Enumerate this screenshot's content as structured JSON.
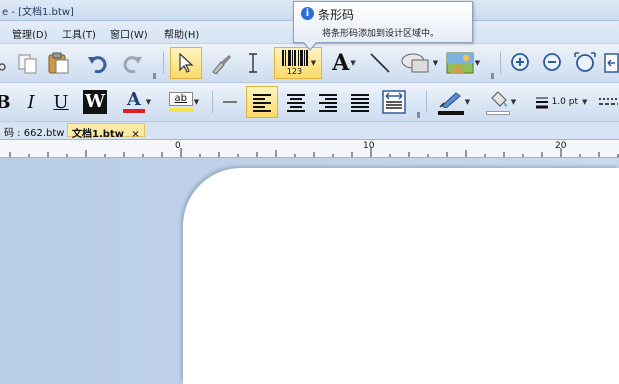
{
  "window": {
    "title": "e - [文档1.btw]"
  },
  "menu": {
    "items": [
      "管理(D)",
      "工具(T)",
      "窗口(W)",
      "帮助(H)"
    ]
  },
  "tooltip": {
    "title": "条形码",
    "description": "将条形码添加到设计区域中。"
  },
  "toolbar": {
    "barcode_caption": "123",
    "font_glyph": "A",
    "italic": "I",
    "underline": "U",
    "wordart": "W",
    "font_color_glyph": "A",
    "highlight_text": "ab",
    "line_width": "1.0 pt"
  },
  "doc_tabs": [
    {
      "label": "码 : 662.btw",
      "active": false
    },
    {
      "label": "文档1.btw",
      "active": true,
      "close": "×"
    }
  ],
  "ruler": {
    "labels": [
      "0",
      "10",
      "20"
    ]
  },
  "colors": {
    "workspace": "#c3d4e8",
    "toolbar_hover": "#fbd96a",
    "font_color_underline": "#e02020",
    "info_blue": "#2a6fd6"
  }
}
